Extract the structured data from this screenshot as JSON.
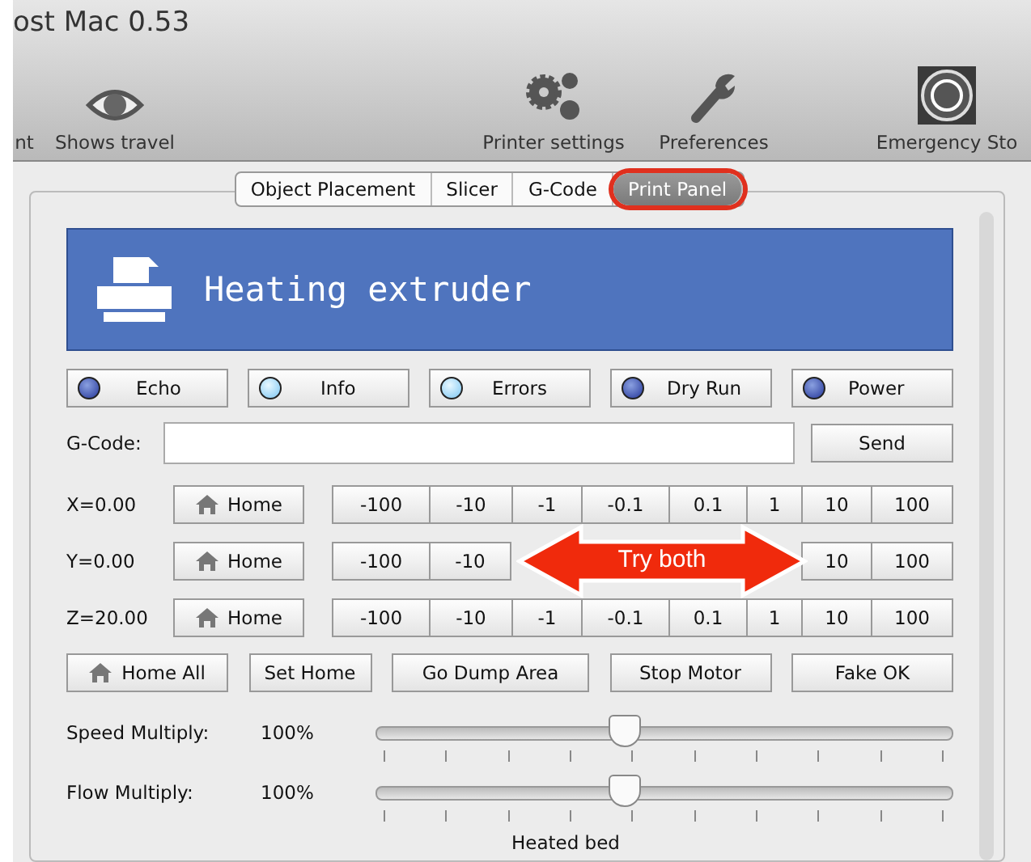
{
  "window": {
    "title": "ost Mac 0.53"
  },
  "toolbar": [
    {
      "kind": "none",
      "label": "nt"
    },
    {
      "kind": "eye",
      "label": "Shows travel"
    },
    {
      "kind": "gears",
      "label": "Printer settings"
    },
    {
      "kind": "wrench",
      "label": "Preferences"
    },
    {
      "kind": "stop",
      "label": "Emergency Sto"
    }
  ],
  "tabs": [
    {
      "label": "Object Placement",
      "selected": false,
      "highlighted": false
    },
    {
      "label": "Slicer",
      "selected": false,
      "highlighted": false
    },
    {
      "label": "G-Code",
      "selected": false,
      "highlighted": false
    },
    {
      "label": "Print Panel",
      "selected": true,
      "highlighted": true
    }
  ],
  "banner": {
    "title": "Heating extruder"
  },
  "toggles": [
    {
      "label": "Echo",
      "on": false
    },
    {
      "label": "Info",
      "on": true
    },
    {
      "label": "Errors",
      "on": true
    },
    {
      "label": "Dry Run",
      "on": false
    },
    {
      "label": "Power",
      "on": false
    }
  ],
  "gcode": {
    "label": "G-Code:",
    "button": "Send"
  },
  "axes": [
    {
      "label": "X=0.00",
      "home": "Home",
      "steps": [
        "-100",
        "-10",
        "-1",
        "-0.1",
        "0.1",
        "1",
        "10",
        "100"
      ]
    },
    {
      "label": "Y=0.00",
      "home": "Home",
      "steps": [
        "-100",
        "-10",
        "10",
        "100"
      ]
    },
    {
      "label": "Z=20.00",
      "home": "Home",
      "steps": [
        "-100",
        "-10",
        "-1",
        "-0.1",
        "0.1",
        "1",
        "10",
        "100"
      ]
    }
  ],
  "annotation": {
    "label": "Try both"
  },
  "actions": [
    {
      "label": "Home All",
      "kind": "home"
    },
    {
      "label": "Set Home",
      "kind": "plain"
    },
    {
      "label": "Go Dump Area",
      "kind": "plain"
    },
    {
      "label": "Stop Motor",
      "kind": "plain"
    },
    {
      "label": "Fake OK",
      "kind": "plain"
    }
  ],
  "sliders": [
    {
      "label": "Speed Multiply:",
      "reading": "100%",
      "level": 0.43
    },
    {
      "label": "Flow Multiply:",
      "reading": "100%",
      "level": 0.43
    }
  ],
  "footer": [
    "Heated bed"
  ]
}
